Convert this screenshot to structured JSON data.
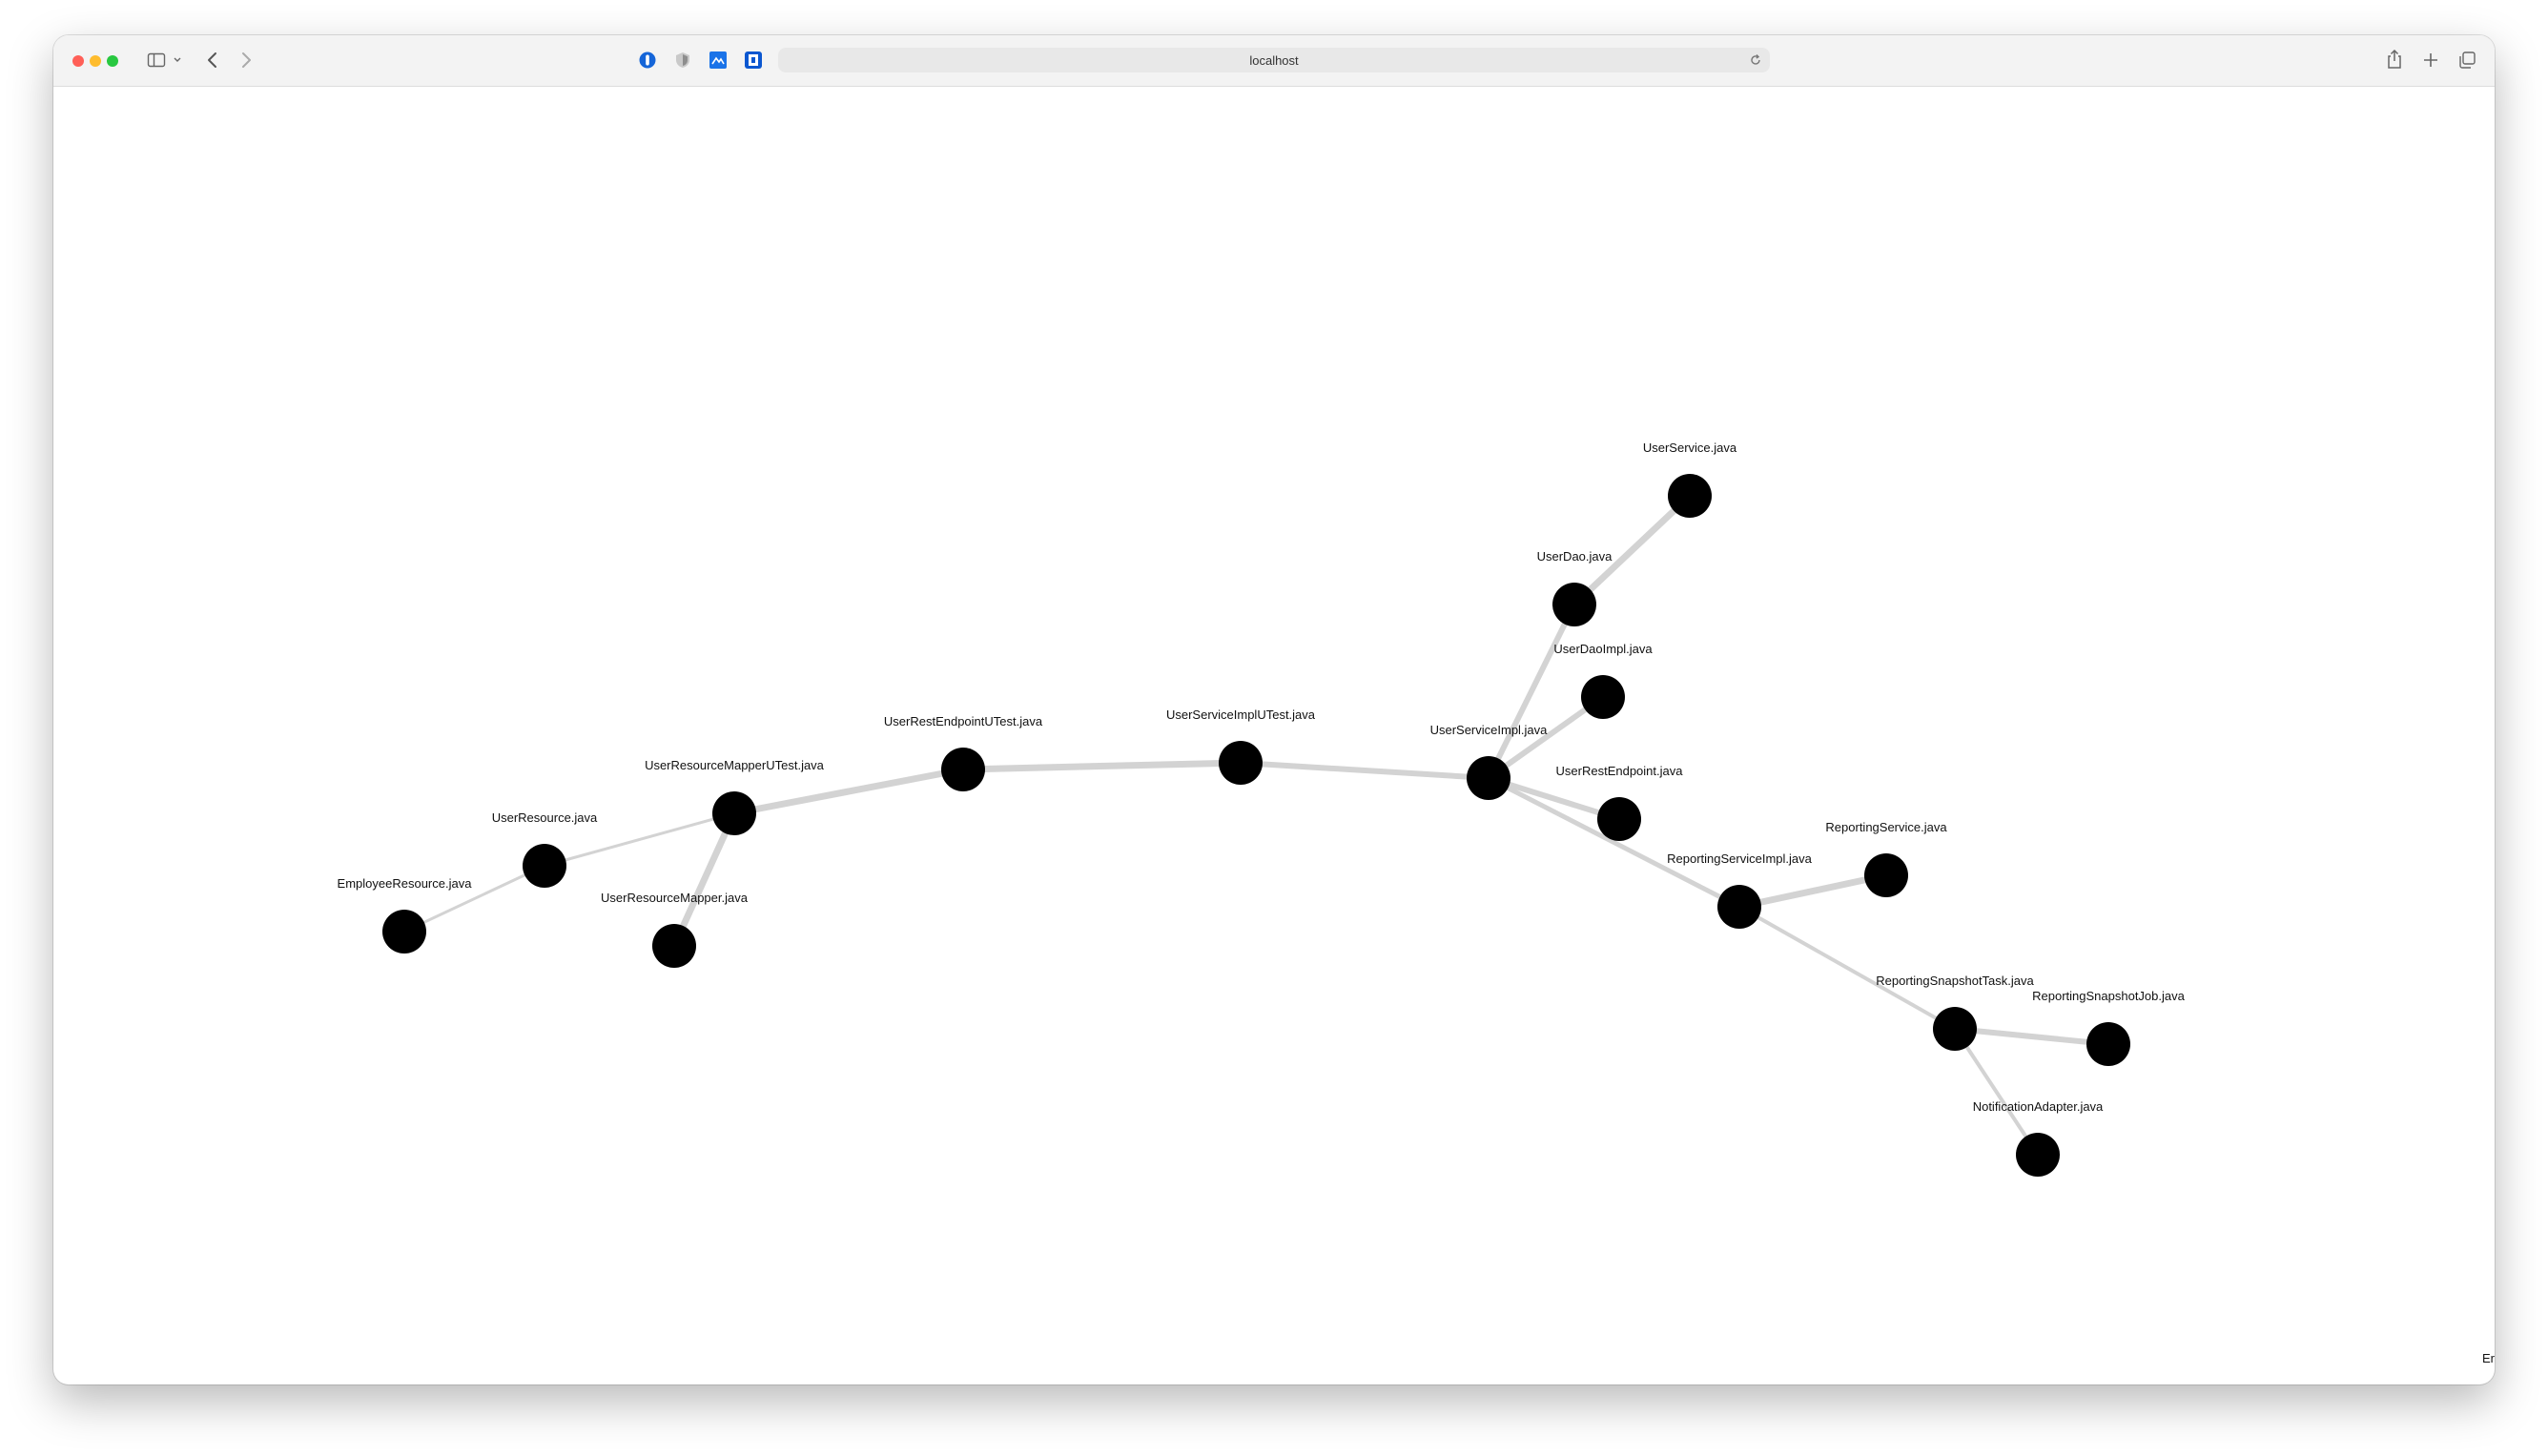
{
  "browser": {
    "address": "localhost",
    "colors": {
      "close": "#ff5f57",
      "minimize": "#febc2e",
      "maximize": "#28c840",
      "edge": "#d3d3d3",
      "node": "#000000"
    },
    "icons": [
      "sidebar-icon",
      "chevron-down-icon",
      "back-arrow-icon",
      "forward-arrow-icon",
      "password-manager-extension-icon",
      "privacy-shield-extension-icon",
      "image-extension-icon",
      "bookmark-extension-icon",
      "reload-icon",
      "share-icon",
      "new-tab-icon",
      "tab-overview-icon"
    ]
  },
  "graph": {
    "nodes": [
      {
        "id": "UserService.java",
        "label": "UserService.java"
      },
      {
        "id": "UserDao.java",
        "label": "UserDao.java"
      },
      {
        "id": "UserDaoImpl.java",
        "label": "UserDaoImpl.java"
      },
      {
        "id": "UserServiceImpl.java",
        "label": "UserServiceImpl.java"
      },
      {
        "id": "UserRestEndpoint.java",
        "label": "UserRestEndpoint.java"
      },
      {
        "id": "UserServiceImplUTest.java",
        "label": "UserServiceImplUTest.java"
      },
      {
        "id": "UserRestEndpointUTest.java",
        "label": "UserRestEndpointUTest.java"
      },
      {
        "id": "UserResourceMapperUTest.java",
        "label": "UserResourceMapperUTest.java"
      },
      {
        "id": "UserResource.java",
        "label": "UserResource.java"
      },
      {
        "id": "EmployeeResource.java",
        "label": "EmployeeResource.java"
      },
      {
        "id": "UserResourceMapper.java",
        "label": "UserResourceMapper.java"
      },
      {
        "id": "ReportingService.java",
        "label": "ReportingService.java"
      },
      {
        "id": "ReportingServiceImpl.java",
        "label": "ReportingServiceImpl.java"
      },
      {
        "id": "ReportingSnapshotTask.java",
        "label": "ReportingSnapshotTask.java"
      },
      {
        "id": "ReportingSnapshotJob.java",
        "label": "ReportingSnapshotJob.java"
      },
      {
        "id": "NotificationAdapter.java",
        "label": "NotificationAdapter.java"
      }
    ],
    "edges": [
      {
        "source": "UserService.java",
        "target": "UserDao.java"
      },
      {
        "source": "UserDao.java",
        "target": "UserServiceImpl.java"
      },
      {
        "source": "UserDaoImpl.java",
        "target": "UserServiceImpl.java"
      },
      {
        "source": "UserServiceImpl.java",
        "target": "UserRestEndpoint.java"
      },
      {
        "source": "UserServiceImpl.java",
        "target": "ReportingServiceImpl.java"
      },
      {
        "source": "UserServiceImplUTest.java",
        "target": "UserServiceImpl.java"
      },
      {
        "source": "UserRestEndpointUTest.java",
        "target": "UserServiceImplUTest.java"
      },
      {
        "source": "UserResourceMapperUTest.java",
        "target": "UserRestEndpointUTest.java"
      },
      {
        "source": "UserResource.java",
        "target": "UserResourceMapperUTest.java"
      },
      {
        "source": "EmployeeResource.java",
        "target": "UserResource.java"
      },
      {
        "source": "UserResourceMapper.java",
        "target": "UserResourceMapperUTest.java"
      },
      {
        "source": "ReportingServiceImpl.java",
        "target": "ReportingService.java"
      },
      {
        "source": "ReportingServiceImpl.java",
        "target": "ReportingSnapshotTask.java"
      },
      {
        "source": "ReportingSnapshotTask.java",
        "target": "ReportingSnapshotJob.java"
      },
      {
        "source": "ReportingSnapshotTask.java",
        "target": "NotificationAdapter.java"
      }
    ],
    "offscreen_label": "Er"
  }
}
